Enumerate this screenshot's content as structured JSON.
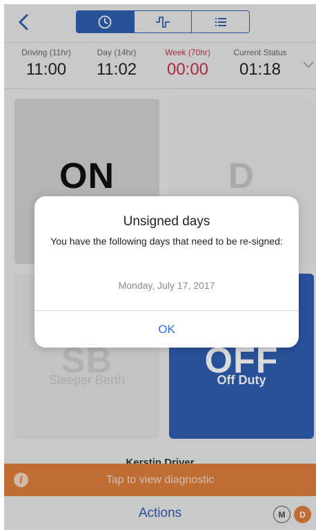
{
  "header": {
    "back_icon": "chevron-left-icon",
    "tabs": [
      {
        "icon": "clock-icon",
        "active": true
      },
      {
        "icon": "duty-graph-icon",
        "active": false
      },
      {
        "icon": "list-icon",
        "active": false
      }
    ]
  },
  "hours": [
    {
      "label": "Driving (11hr)",
      "value": "11:00",
      "warning": false
    },
    {
      "label": "Day (14hr)",
      "value": "11:02",
      "warning": false
    },
    {
      "label": "Week (70hr)",
      "value": "00:00",
      "warning": true
    },
    {
      "label": "Current Status",
      "value": "01:18",
      "warning": false
    }
  ],
  "tiles": {
    "on": {
      "code": "ON"
    },
    "d": {
      "code": "D"
    },
    "sb": {
      "code": "SB",
      "label": "Sleeper Berth"
    },
    "off": {
      "code": "OFF",
      "label": "Off Duty"
    }
  },
  "driver_name": "Kerstin Driver",
  "diagnostic": {
    "text": "Tap to view diagnostic",
    "icon": "info-icon"
  },
  "bottom": {
    "actions_label": "Actions",
    "mode_m": "M",
    "mode_d": "D"
  },
  "dialog": {
    "title": "Unsigned days",
    "message": "You have the following days that need to be re-signed:",
    "date": "Monday, July 17, 2017",
    "ok_label": "OK"
  },
  "colors": {
    "primary": "#2f5fb3",
    "warning": "#c2344a",
    "diagnostic": "#e07f3d",
    "ok_link": "#2f6ce0"
  }
}
